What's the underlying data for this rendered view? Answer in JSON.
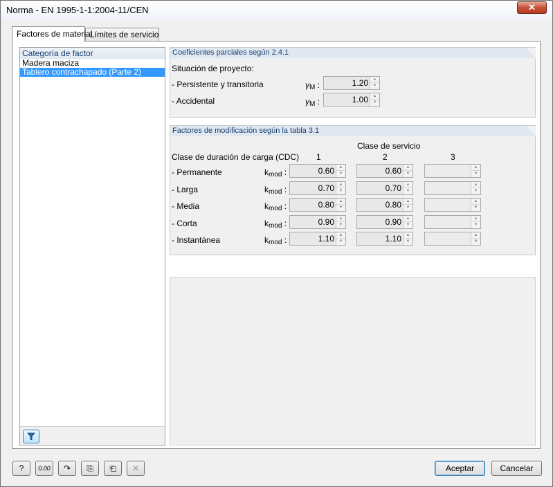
{
  "window": {
    "title": "Norma - EN 1995-1-1:2004-11/CEN",
    "close_label": "✕"
  },
  "tabs": [
    {
      "label": "Factores de material"
    },
    {
      "label": "Límites de servicio"
    }
  ],
  "category_panel": {
    "header": "Categoría de factor",
    "items": [
      {
        "label": "Madera maciza"
      },
      {
        "label": "Tablero contrachapado (Parte 2)"
      }
    ],
    "filter_icon": "filter-icon"
  },
  "partial": {
    "title": "Coeficientes parciales según 2.4.1",
    "situation_label": "Situación de proyecto:",
    "rows": [
      {
        "label": "- Persistente y transitoria",
        "symbol": "γ",
        "sub": "M",
        "colon": ":",
        "value": "1.20"
      },
      {
        "label": "- Accidental",
        "symbol": "γ",
        "sub": "M",
        "colon": ":",
        "value": "1.00"
      }
    ]
  },
  "modification": {
    "title": "Factores de modificación según la tabla 3.1",
    "service_class_label": "Clase de servicio",
    "duration_label": "Clase de duración de carga (CDC)",
    "columns": [
      "1",
      "2",
      "3"
    ],
    "symbol": "k",
    "sub": "mod",
    "colon": ":",
    "rows": [
      {
        "label": "- Permanente",
        "values": [
          "0.60",
          "0.60",
          ""
        ]
      },
      {
        "label": "- Larga",
        "values": [
          "0.70",
          "0.70",
          ""
        ]
      },
      {
        "label": "- Media",
        "values": [
          "0.80",
          "0.80",
          ""
        ]
      },
      {
        "label": "- Corta",
        "values": [
          "0.90",
          "0.90",
          ""
        ]
      },
      {
        "label": "- Instantánea",
        "values": [
          "1.10",
          "1.10",
          ""
        ]
      }
    ]
  },
  "footer": {
    "tools": [
      {
        "icon": "help-icon",
        "glyph": "?"
      },
      {
        "icon": "decimal-places-icon",
        "glyph": "0.00"
      },
      {
        "icon": "reset-icon",
        "glyph": "↷"
      },
      {
        "icon": "export-icon",
        "glyph": "⎘"
      },
      {
        "icon": "import-icon",
        "glyph": "⎗"
      },
      {
        "icon": "delete-icon",
        "glyph": "✕"
      }
    ],
    "ok_label": "Aceptar",
    "cancel_label": "Cancelar"
  }
}
